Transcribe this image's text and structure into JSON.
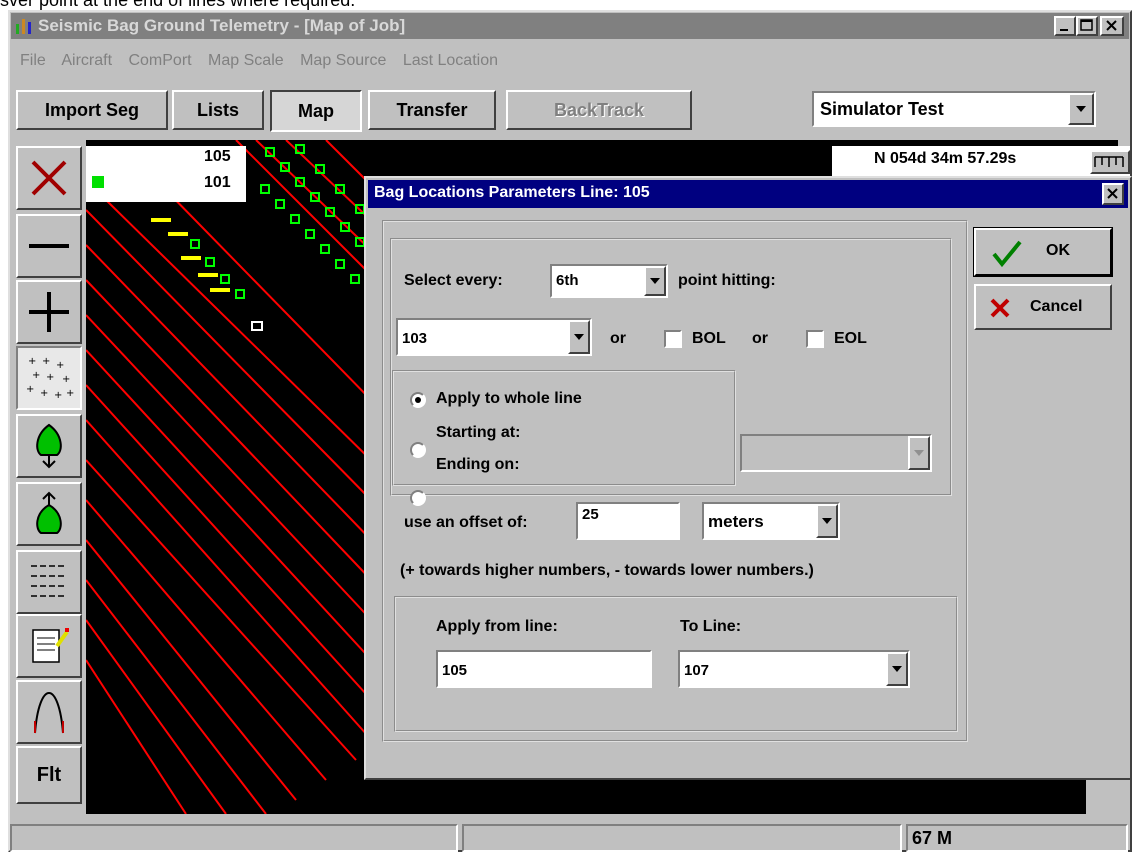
{
  "caption": "sver point at the end of lines where required.",
  "window": {
    "title": "Seismic Bag Ground Telemetry - [Map of Job]",
    "controls": [
      "_",
      "□",
      "×"
    ]
  },
  "menu": [
    "File",
    "Aircraft",
    "ComPort",
    "Map Scale",
    "Map Source",
    "Last Location"
  ],
  "toolbar": {
    "import_seg": "Import Seg",
    "lists": "Lists",
    "map": "Map",
    "transfer": "Transfer",
    "backtrack": "BackTrack",
    "source_select": "Simulator Test"
  },
  "sidebar": {
    "flt_label": "Flt"
  },
  "map": {
    "line_top": "105",
    "line_bottom": "101",
    "coordinate": "N 054d 34m 57.29s"
  },
  "dialog": {
    "title": "Bag Locations Parameters Line: 105",
    "select_every_label": "Select every:",
    "select_every_value": "6th",
    "point_hitting_label": "point hitting:",
    "point_value": "103",
    "or1": "or",
    "bol_label": "BOL",
    "or2": "or",
    "eol_label": "EOL",
    "apply_whole_line": "Apply to whole line",
    "starting_at": "Starting at:",
    "ending_on": "Ending on:",
    "offset_label": "use an offset of:",
    "offset_value": "25",
    "offset_units": "meters",
    "hint": "(+ towards higher numbers, - towards lower numbers.)",
    "apply_from_label": "Apply from line:",
    "apply_from_value": "105",
    "to_line_label": "To Line:",
    "to_line_value": "107",
    "ok_label": "OK",
    "cancel_label": "Cancel"
  },
  "status": {
    "scale": "67 M"
  },
  "colors": {
    "title_bar": "#808080",
    "dialog_title": "#000080",
    "map_bg": "#000000",
    "seismic_line": "#ff0000",
    "bag_marker": "#00ff00"
  }
}
